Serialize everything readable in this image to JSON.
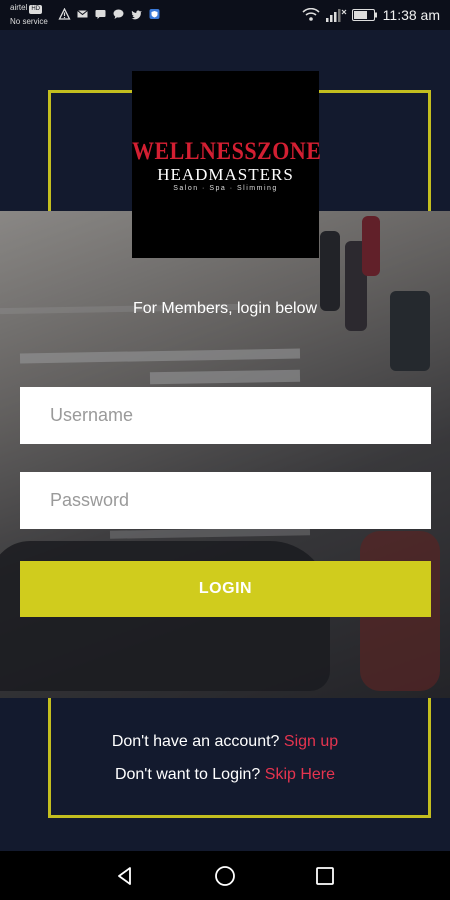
{
  "status_bar": {
    "carrier": "airtel",
    "carrier_badge": "HD",
    "network": "No service",
    "time": "11:38 am",
    "icons": [
      "warning-icon",
      "mail-icon",
      "message-icon",
      "twitter-icon",
      "shield-app-icon",
      "wifi-icon",
      "signal-icon",
      "battery-icon"
    ]
  },
  "logo": {
    "line1": "WELLNESSZONE",
    "line2": "HEADMASTERS",
    "line3": "Salon · Spa · Slimming"
  },
  "login": {
    "heading": "For Members, login below",
    "username_placeholder": "Username",
    "password_placeholder": "Password",
    "button_label": "LOGIN"
  },
  "footer": {
    "signup_prompt": "Don't have an account?",
    "signup_link": "Sign up",
    "skip_prompt": "Don't want to Login?",
    "skip_link": "Skip Here"
  },
  "colors": {
    "background": "#131a2e",
    "accent": "#d0cc1d",
    "link": "#e5344f",
    "brand_red": "#d31f32"
  },
  "nav": {
    "icons": [
      "back-icon",
      "home-icon",
      "recents-icon"
    ]
  }
}
